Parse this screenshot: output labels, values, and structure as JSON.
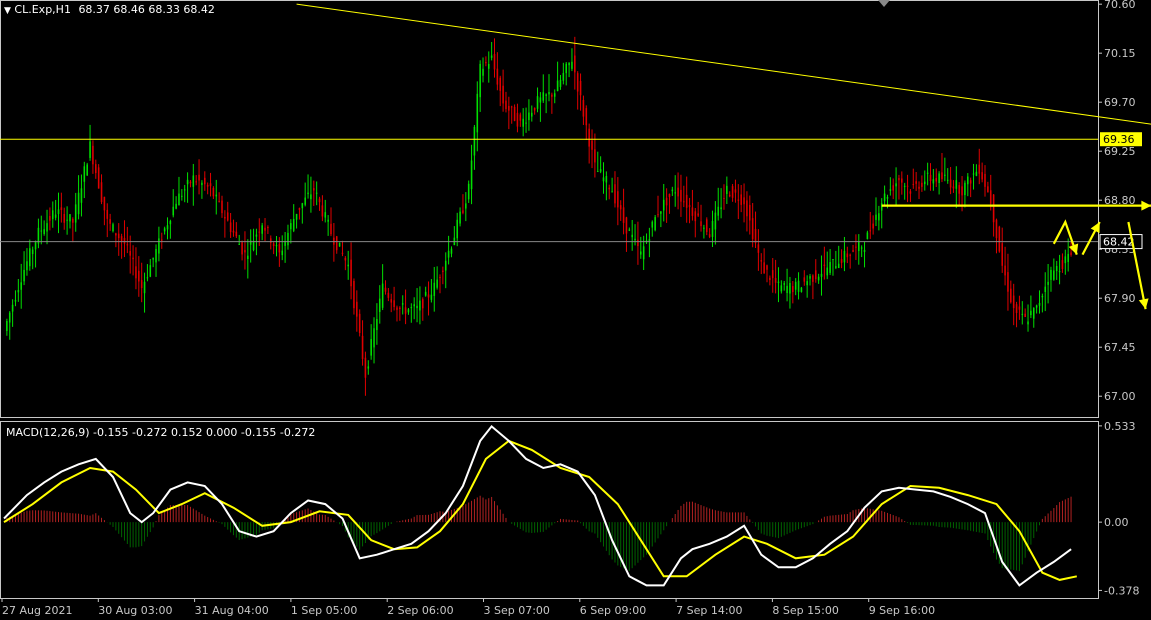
{
  "header": {
    "symbol_text": "CL.Exp,H1",
    "ohlc_text": "68.37 68.46 68.33 68.42",
    "dropdown_glyph": "▼"
  },
  "indicator": {
    "label": "MACD(12,26,9) -0.155 -0.272 0.152 0.000 -0.155 -0.272"
  },
  "colors": {
    "background": "#000000",
    "grid": "#1f1f1f",
    "axis": "#c8c8c8",
    "bull": "#00e000",
    "bear": "#e00000",
    "hist_pos": "#b22222",
    "hist_neg": "#006400",
    "yellow": "#ffff00",
    "macd_line": "#ffffff",
    "signal_line": "#ffff00",
    "price_line": "#888888"
  },
  "chart_data": [
    {
      "type": "candlestick",
      "symbol": "CL.Exp",
      "timeframe": "H1",
      "ylim": [
        66.8,
        70.62
      ],
      "yticks": [
        "70.60",
        "70.15",
        "69.70",
        "69.25",
        "68.80",
        "68.35",
        "67.90",
        "67.45",
        "67.00"
      ],
      "current_price": "68.42",
      "horizontal_level": "69.36",
      "xticks": [
        "27 Aug 2021",
        "30 Aug 03:00",
        "31 Aug 04:00",
        "1 Sep 05:00",
        "2 Sep 06:00",
        "3 Sep 07:00",
        "6 Sep 09:00",
        "7 Sep 14:00",
        "8 Sep 15:00",
        "9 Sep 16:00"
      ],
      "close_path": [
        [
          0,
          67.6
        ],
        [
          6,
          68.1
        ],
        [
          12,
          68.5
        ],
        [
          18,
          68.7
        ],
        [
          24,
          68.6
        ],
        [
          30,
          69.3
        ],
        [
          36,
          68.6
        ],
        [
          42,
          68.4
        ],
        [
          48,
          68.0
        ],
        [
          54,
          68.4
        ],
        [
          60,
          68.8
        ],
        [
          66,
          69.0
        ],
        [
          72,
          68.9
        ],
        [
          78,
          68.6
        ],
        [
          84,
          68.3
        ],
        [
          90,
          68.6
        ],
        [
          96,
          68.3
        ],
        [
          102,
          68.7
        ],
        [
          108,
          68.9
        ],
        [
          114,
          68.5
        ],
        [
          120,
          68.2
        ],
        [
          126,
          67.2
        ],
        [
          132,
          68.0
        ],
        [
          138,
          67.8
        ],
        [
          144,
          67.8
        ],
        [
          150,
          68.0
        ],
        [
          156,
          68.4
        ],
        [
          162,
          68.9
        ],
        [
          166,
          70.0
        ],
        [
          170,
          70.1
        ],
        [
          174,
          69.7
        ],
        [
          180,
          69.5
        ],
        [
          186,
          69.7
        ],
        [
          192,
          69.8
        ],
        [
          198,
          70.1
        ],
        [
          202,
          69.6
        ],
        [
          206,
          69.1
        ],
        [
          212,
          68.9
        ],
        [
          216,
          68.6
        ],
        [
          222,
          68.3
        ],
        [
          228,
          68.7
        ],
        [
          234,
          68.9
        ],
        [
          240,
          68.7
        ],
        [
          246,
          68.5
        ],
        [
          252,
          68.9
        ],
        [
          258,
          68.8
        ],
        [
          264,
          68.2
        ],
        [
          270,
          68.0
        ],
        [
          276,
          68.0
        ],
        [
          282,
          68.1
        ],
        [
          288,
          68.2
        ],
        [
          294,
          68.3
        ],
        [
          300,
          68.4
        ],
        [
          306,
          68.8
        ],
        [
          312,
          69.0
        ],
        [
          316,
          68.9
        ],
        [
          322,
          69.0
        ],
        [
          328,
          69.0
        ],
        [
          334,
          68.9
        ],
        [
          340,
          69.1
        ],
        [
          344,
          68.8
        ],
        [
          346,
          68.5
        ],
        [
          348,
          68.2
        ],
        [
          352,
          67.8
        ],
        [
          356,
          67.7
        ],
        [
          360,
          67.8
        ],
        [
          364,
          68.1
        ],
        [
          368,
          68.2
        ],
        [
          372,
          68.3
        ]
      ],
      "future_arrows": [
        [
          [
            366,
            68.4
          ],
          [
            370,
            68.6
          ],
          [
            374,
            68.3
          ]
        ],
        [
          [
            376,
            68.3
          ],
          [
            382,
            68.6
          ]
        ],
        [
          [
            392,
            68.6
          ],
          [
            398,
            67.8
          ]
        ],
        [
          [
            306,
            68.75
          ],
          [
            400,
            68.75
          ]
        ]
      ],
      "trendline": [
        [
          102,
          70.6
        ],
        [
          440,
          69.35
        ]
      ]
    },
    {
      "type": "line",
      "title": "MACD(12,26,9)",
      "ylim": [
        -0.42,
        0.56
      ],
      "yticks": [
        "0.533",
        "0.00",
        "-0.378"
      ],
      "series": [
        {
          "name": "MACD",
          "points": [
            [
              0,
              0.02
            ],
            [
              8,
              0.15
            ],
            [
              14,
              0.22
            ],
            [
              20,
              0.28
            ],
            [
              26,
              0.32
            ],
            [
              32,
              0.35
            ],
            [
              38,
              0.25
            ],
            [
              44,
              0.05
            ],
            [
              48,
              0.0
            ],
            [
              52,
              0.05
            ],
            [
              58,
              0.18
            ],
            [
              64,
              0.22
            ],
            [
              70,
              0.2
            ],
            [
              76,
              0.1
            ],
            [
              82,
              -0.05
            ],
            [
              88,
              -0.08
            ],
            [
              94,
              -0.05
            ],
            [
              100,
              0.05
            ],
            [
              106,
              0.12
            ],
            [
              112,
              0.1
            ],
            [
              118,
              0.02
            ],
            [
              124,
              -0.2
            ],
            [
              130,
              -0.18
            ],
            [
              136,
              -0.15
            ],
            [
              142,
              -0.12
            ],
            [
              148,
              -0.05
            ],
            [
              154,
              0.05
            ],
            [
              160,
              0.2
            ],
            [
              166,
              0.45
            ],
            [
              170,
              0.53
            ],
            [
              176,
              0.45
            ],
            [
              182,
              0.35
            ],
            [
              188,
              0.3
            ],
            [
              194,
              0.32
            ],
            [
              200,
              0.28
            ],
            [
              206,
              0.15
            ],
            [
              212,
              -0.1
            ],
            [
              218,
              -0.3
            ],
            [
              224,
              -0.35
            ],
            [
              230,
              -0.35
            ],
            [
              236,
              -0.2
            ],
            [
              240,
              -0.15
            ],
            [
              246,
              -0.12
            ],
            [
              252,
              -0.08
            ],
            [
              258,
              -0.02
            ],
            [
              264,
              -0.18
            ],
            [
              270,
              -0.25
            ],
            [
              276,
              -0.25
            ],
            [
              282,
              -0.2
            ],
            [
              288,
              -0.12
            ],
            [
              294,
              -0.05
            ],
            [
              300,
              0.08
            ],
            [
              306,
              0.17
            ],
            [
              312,
              0.19
            ],
            [
              318,
              0.18
            ],
            [
              324,
              0.17
            ],
            [
              330,
              0.14
            ],
            [
              336,
              0.1
            ],
            [
              342,
              0.05
            ],
            [
              348,
              -0.22
            ],
            [
              354,
              -0.35
            ],
            [
              360,
              -0.28
            ],
            [
              366,
              -0.22
            ],
            [
              372,
              -0.15
            ]
          ]
        },
        {
          "name": "Signal",
          "points": [
            [
              0,
              0.0
            ],
            [
              10,
              0.1
            ],
            [
              20,
              0.22
            ],
            [
              30,
              0.3
            ],
            [
              38,
              0.28
            ],
            [
              46,
              0.18
            ],
            [
              54,
              0.05
            ],
            [
              62,
              0.1
            ],
            [
              70,
              0.16
            ],
            [
              80,
              0.08
            ],
            [
              90,
              -0.02
            ],
            [
              100,
              0.0
            ],
            [
              110,
              0.06
            ],
            [
              120,
              0.04
            ],
            [
              128,
              -0.1
            ],
            [
              136,
              -0.15
            ],
            [
              144,
              -0.14
            ],
            [
              152,
              -0.05
            ],
            [
              160,
              0.1
            ],
            [
              168,
              0.35
            ],
            [
              176,
              0.45
            ],
            [
              184,
              0.4
            ],
            [
              194,
              0.3
            ],
            [
              204,
              0.25
            ],
            [
              214,
              0.1
            ],
            [
              222,
              -0.1
            ],
            [
              230,
              -0.3
            ],
            [
              238,
              -0.3
            ],
            [
              248,
              -0.18
            ],
            [
              258,
              -0.08
            ],
            [
              266,
              -0.12
            ],
            [
              276,
              -0.2
            ],
            [
              286,
              -0.18
            ],
            [
              296,
              -0.08
            ],
            [
              306,
              0.1
            ],
            [
              316,
              0.2
            ],
            [
              326,
              0.19
            ],
            [
              336,
              0.15
            ],
            [
              346,
              0.1
            ],
            [
              354,
              -0.05
            ],
            [
              362,
              -0.28
            ],
            [
              368,
              -0.32
            ],
            [
              374,
              -0.3
            ]
          ]
        }
      ]
    }
  ]
}
